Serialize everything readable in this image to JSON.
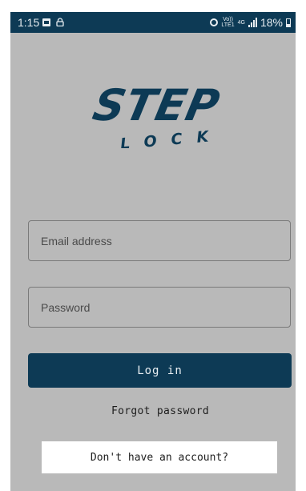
{
  "status_bar": {
    "time": "1:15",
    "battery_percent": "18%",
    "network_4g": "4G",
    "volte_line1": "Vo))",
    "volte_line2": "LTE1"
  },
  "logo": {
    "word_main": "STEP",
    "word_sub": "LOCK",
    "color": "#0d3a55"
  },
  "login_form": {
    "email_placeholder": "Email address",
    "password_placeholder": "Password",
    "login_label": "Log in",
    "forgot_password_label": "Forgot password",
    "signup_label": "Don't have an account?"
  },
  "colors": {
    "accent": "#0d3a55",
    "background": "#b9b9b9"
  }
}
